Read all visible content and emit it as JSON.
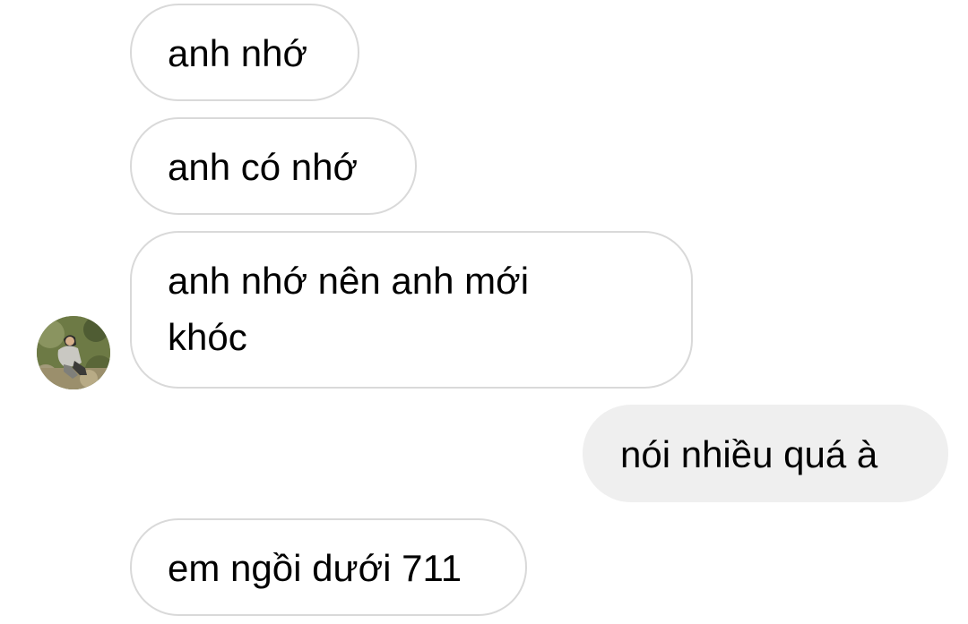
{
  "messages": [
    {
      "text": "anh nhớ",
      "direction": "incoming"
    },
    {
      "text": "anh có nhớ",
      "direction": "incoming"
    },
    {
      "text": "anh nhớ nên anh mới khóc",
      "direction": "incoming"
    },
    {
      "text": "nói nhiều quá à",
      "direction": "outgoing"
    },
    {
      "text": "em ngồi dưới 711",
      "direction": "incoming"
    }
  ],
  "avatar": {
    "icon": "person-photo-avatar"
  },
  "colors": {
    "incoming_border": "#d9d9d9",
    "outgoing_background": "#efefef",
    "text": "#000000"
  }
}
